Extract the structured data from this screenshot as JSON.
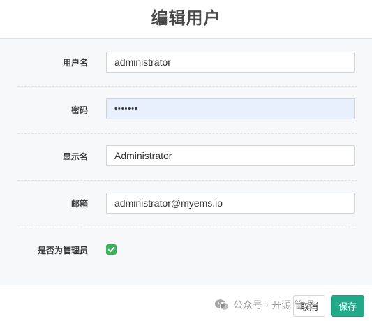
{
  "dialog": {
    "title": "编辑用户"
  },
  "form": {
    "username": {
      "label": "用户名",
      "value": "administrator"
    },
    "password": {
      "label": "密码",
      "value": "•••••••"
    },
    "display_name": {
      "label": "显示名",
      "value": "Administrator"
    },
    "email": {
      "label": "邮箱",
      "value": "administrator@myems.io"
    },
    "is_admin": {
      "label": "是否为管理员",
      "checked": true
    }
  },
  "footer": {
    "cancel_label": "取消",
    "save_label": "保存"
  },
  "watermark": {
    "text": "公众号 · 开源 管理",
    "icon": "wechat-icon"
  },
  "colors": {
    "checkbox": "#3eaf5c",
    "save_button": "#21a98a",
    "password_bg": "#e8f0fe"
  }
}
